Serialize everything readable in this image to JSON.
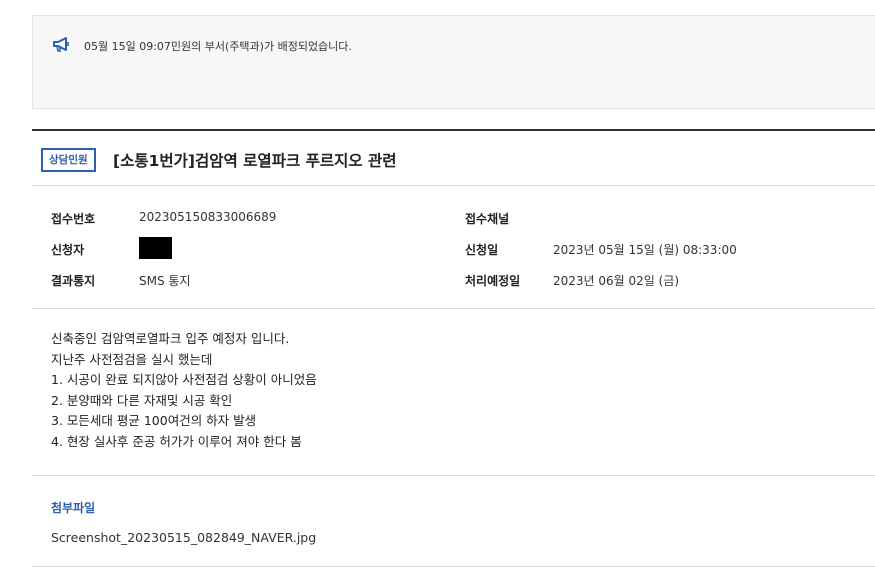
{
  "notice": {
    "icon": "megaphone-icon",
    "text": "05월 15일 09:07민원의 부서(주택과)가 배정되었습니다."
  },
  "complaint": {
    "badge": "상담민원",
    "title": "[소통1번가]검암역 로열파크 푸르지오 관련"
  },
  "info": {
    "receipt_no_label": "접수번호",
    "receipt_no": "202305150833006689",
    "channel_label": "접수채널",
    "channel": "",
    "applicant_label": "신청자",
    "apply_date_label": "신청일",
    "apply_date": "2023년 05월 15일 (월) 08:33:00",
    "result_notice_label": "결과통지",
    "result_notice": "SMS 통지",
    "due_date_label": "처리예정일",
    "due_date": "2023년 06월 02일 (금)"
  },
  "body_lines": [
    "신축중인 검암역로열파크 입주 예정자 입니다.",
    "지난주 사전점검을 실시 했는데",
    "1. 시공이 완료 되지않아 사전점검 상황이 아니었음",
    "2. 분양때와 다른 자재및 시공 확인",
    "3. 모든세대 평균 100여건의 하자 발생",
    "4. 현장 실사후 준공 허가가 이루어 져야 한다 봄"
  ],
  "attachments": {
    "title": "첨부파일",
    "files": [
      "Screenshot_20230515_082849_NAVER.jpg"
    ]
  },
  "colors": {
    "accent": "#2d5fb3",
    "notice_bg": "#f7f7f8"
  }
}
